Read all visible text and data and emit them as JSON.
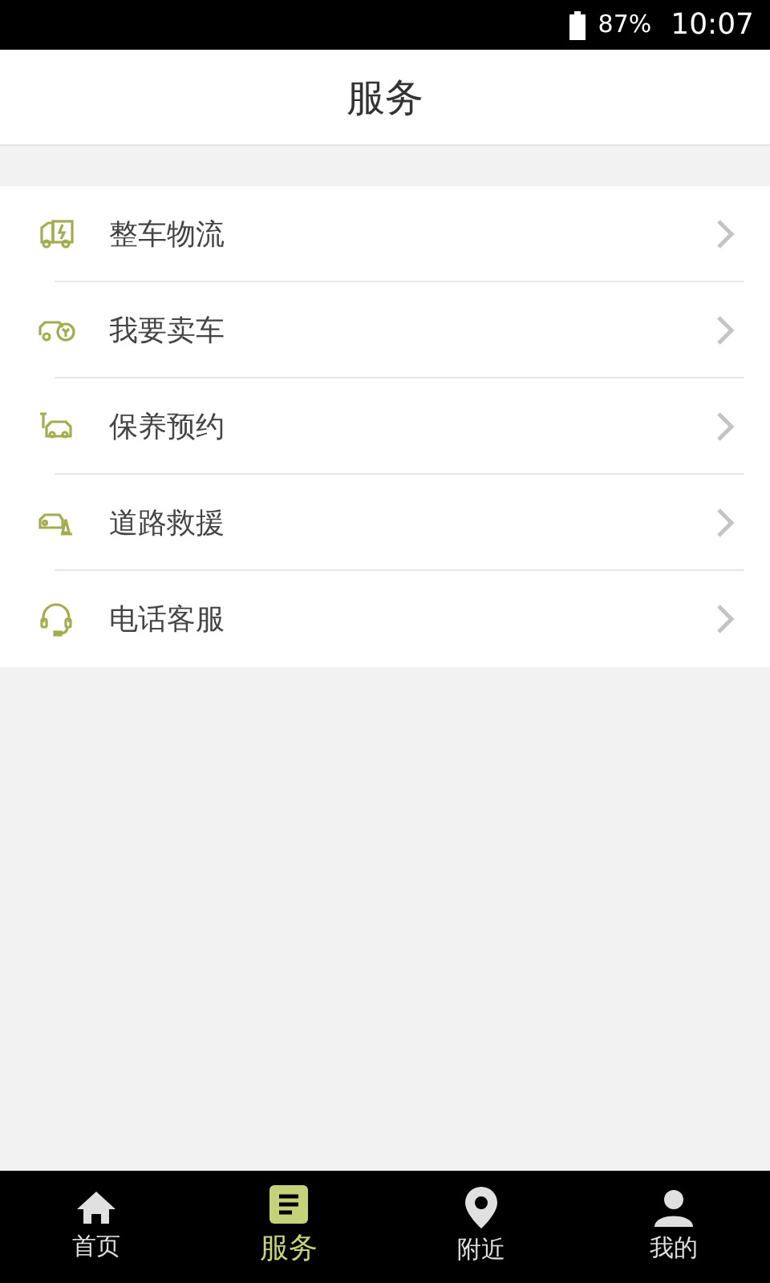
{
  "status_bar": {
    "battery": "87%",
    "time": "10:07"
  },
  "header": {
    "title": "服务"
  },
  "services": [
    {
      "kind": "truck",
      "label": "整车物流"
    },
    {
      "kind": "sell",
      "label": "我要卖车"
    },
    {
      "kind": "maintenance",
      "label": "保养预约"
    },
    {
      "kind": "rescue",
      "label": "道路救援"
    },
    {
      "kind": "phone",
      "label": "电话客服"
    }
  ],
  "tabs": [
    {
      "kind": "home",
      "label": "首页",
      "selected": false
    },
    {
      "kind": "service",
      "label": "服务",
      "selected": true
    },
    {
      "kind": "nearby",
      "label": "附近",
      "selected": false
    },
    {
      "kind": "me",
      "label": "我的",
      "selected": false
    }
  ]
}
